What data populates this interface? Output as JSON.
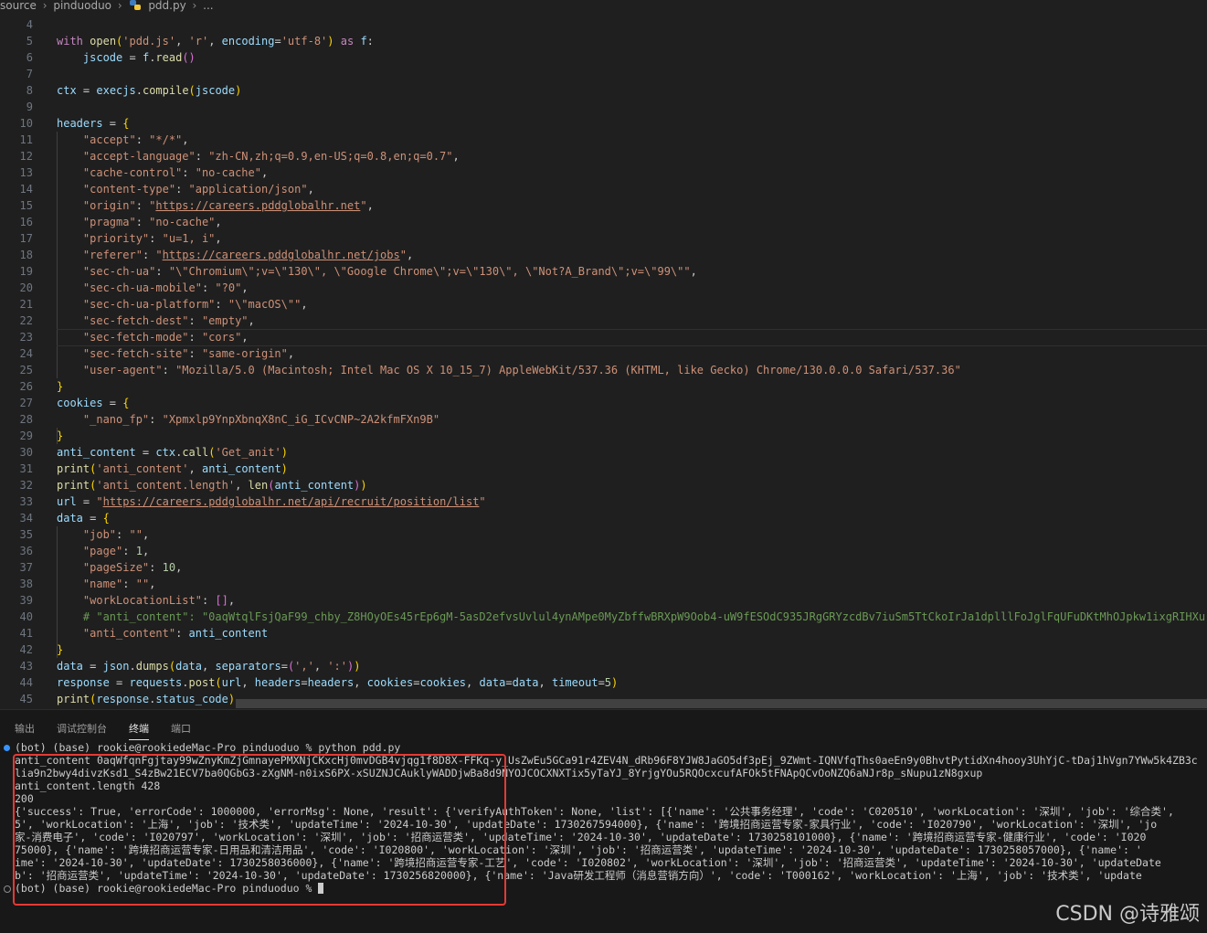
{
  "breadcrumb": {
    "parts": [
      "source",
      "pinduoduo",
      "pdd.py",
      "..."
    ]
  },
  "editor": {
    "lines": [
      {
        "n": "4",
        "html": ""
      },
      {
        "n": "5",
        "html": "<span class='k'>with</span> <span class='f'>open</span><span class='p'>(</span><span class='s'>'pdd.js'</span>, <span class='s'>'r'</span>, <span class='v'>encoding</span>=<span class='s'>'utf-8'</span><span class='p'>)</span> <span class='k'>as</span> <span class='v'>f</span>:"
      },
      {
        "n": "6",
        "html": "    <span class='v'>jscode</span> = <span class='v'>f</span>.<span class='f'>read</span><span class='br'>()</span>"
      },
      {
        "n": "7",
        "html": ""
      },
      {
        "n": "8",
        "html": "<span class='v'>ctx</span> = <span class='v'>execjs</span>.<span class='f'>compile</span><span class='p'>(</span><span class='v'>jscode</span><span class='p'>)</span>"
      },
      {
        "n": "9",
        "html": ""
      },
      {
        "n": "10",
        "html": "<span class='v'>headers</span> = <span class='p'>{</span>"
      },
      {
        "n": "11",
        "html": "    <span class='s'>\"accept\"</span>: <span class='s'>\"*/*\"</span>,"
      },
      {
        "n": "12",
        "html": "    <span class='s'>\"accept-language\"</span>: <span class='s'>\"zh-CN,zh;q=0.9,en-US;q=0.8,en;q=0.7\"</span>,"
      },
      {
        "n": "13",
        "html": "    <span class='s'>\"cache-control\"</span>: <span class='s'>\"no-cache\"</span>,"
      },
      {
        "n": "14",
        "html": "    <span class='s'>\"content-type\"</span>: <span class='s'>\"application/json\"</span>,"
      },
      {
        "n": "15",
        "html": "    <span class='s'>\"origin\"</span>: <span class='s'>\"</span><span class='u'>https://careers.pddglobalhr.net</span><span class='s'>\"</span>,"
      },
      {
        "n": "16",
        "html": "    <span class='s'>\"pragma\"</span>: <span class='s'>\"no-cache\"</span>,"
      },
      {
        "n": "17",
        "html": "    <span class='s'>\"priority\"</span>: <span class='s'>\"u=1, i\"</span>,"
      },
      {
        "n": "18",
        "html": "    <span class='s'>\"referer\"</span>: <span class='s'>\"</span><span class='u'>https://careers.pddglobalhr.net/jobs</span><span class='s'>\"</span>,"
      },
      {
        "n": "19",
        "html": "    <span class='s'>\"sec-ch-ua\"</span>: <span class='s'>\"\\\"Chromium\\\";v=\\\"130\\\", \\\"Google Chrome\\\";v=\\\"130\\\", \\\"Not?A_Brand\\\";v=\\\"99\\\"\"</span>,"
      },
      {
        "n": "20",
        "html": "    <span class='s'>\"sec-ch-ua-mobile\"</span>: <span class='s'>\"?0\"</span>,"
      },
      {
        "n": "21",
        "html": "    <span class='s'>\"sec-ch-ua-platform\"</span>: <span class='s'>\"\\\"macOS\\\"\"</span>,"
      },
      {
        "n": "22",
        "html": "    <span class='s'>\"sec-fetch-dest\"</span>: <span class='s'>\"empty\"</span>,"
      },
      {
        "n": "23",
        "html": "    <span class='s'>\"sec-fetch-mode\"</span>: <span class='s'>\"cors\"</span>,"
      },
      {
        "n": "24",
        "html": "    <span class='s'>\"sec-fetch-site\"</span>: <span class='s'>\"same-origin\"</span>,"
      },
      {
        "n": "25",
        "html": "    <span class='s'>\"user-agent\"</span>: <span class='s'>\"Mozilla/5.0 (Macintosh; Intel Mac OS X 10_15_7) AppleWebKit/537.36 (KHTML, like Gecko) Chrome/130.0.0.0 Safari/537.36\"</span>"
      },
      {
        "n": "26",
        "html": "<span class='p'>}</span>"
      },
      {
        "n": "27",
        "html": "<span class='v'>cookies</span> = <span class='p'>{</span>"
      },
      {
        "n": "28",
        "html": "    <span class='s'>\"_nano_fp\"</span>: <span class='s'>\"Xpmxlp9YnpXbnqX8nC_iG_ICvCNP~2A2kfmFXn9B\"</span>"
      },
      {
        "n": "29",
        "html": "<span class='p'>}</span>"
      },
      {
        "n": "30",
        "html": "<span class='v'>anti_content</span> = <span class='v'>ctx</span>.<span class='f'>call</span><span class='p'>(</span><span class='s'>'Get_anit'</span><span class='p'>)</span>"
      },
      {
        "n": "31",
        "html": "<span class='f'>print</span><span class='p'>(</span><span class='s'>'anti_content'</span>, <span class='v'>anti_content</span><span class='p'>)</span>"
      },
      {
        "n": "32",
        "html": "<span class='f'>print</span><span class='p'>(</span><span class='s'>'anti_content.length'</span>, <span class='f'>len</span><span class='br'>(</span><span class='v'>anti_content</span><span class='br'>)</span><span class='p'>)</span>"
      },
      {
        "n": "33",
        "html": "<span class='v'>url</span> = <span class='s'>\"</span><span class='u'>https://careers.pddglobalhr.net/api/recruit/position/list</span><span class='s'>\"</span>"
      },
      {
        "n": "34",
        "html": "<span class='v'>data</span> = <span class='p'>{</span>"
      },
      {
        "n": "35",
        "html": "    <span class='s'>\"job\"</span>: <span class='s'>\"\"</span>,"
      },
      {
        "n": "36",
        "html": "    <span class='s'>\"page\"</span>: <span class='n'>1</span>,"
      },
      {
        "n": "37",
        "html": "    <span class='s'>\"pageSize\"</span>: <span class='n'>10</span>,"
      },
      {
        "n": "38",
        "html": "    <span class='s'>\"name\"</span>: <span class='s'>\"\"</span>,"
      },
      {
        "n": "39",
        "html": "    <span class='s'>\"workLocationList\"</span>: <span class='br'>[]</span>,"
      },
      {
        "n": "40",
        "html": "    <span class='c'># \"anti_content\": \"0aqWtqlFsjQaF99_chby_Z8HOyOEs45rEp6gM-5asD2efvsUvlul4ynAMpe0MyZbffwBRXpW9Oob4-uW9fESOdC935JRgGRYzcdBv7iuSm5TtCkoIrJa1dplllFoJglFqUFuDKtMhOJpkw1ixgRIHXu</span>"
      },
      {
        "n": "41",
        "html": "    <span class='s'>\"anti_content\"</span>: <span class='v'>anti_content</span>"
      },
      {
        "n": "42",
        "html": "<span class='p'>}</span>"
      },
      {
        "n": "43",
        "html": "<span class='v'>data</span> = <span class='v'>json</span>.<span class='f'>dumps</span><span class='p'>(</span><span class='v'>data</span>, <span class='v'>separators</span>=<span class='br'>(</span><span class='s'>','</span>, <span class='s'>':'</span><span class='br'>)</span><span class='p'>)</span>"
      },
      {
        "n": "44",
        "html": "<span class='v'>response</span> = <span class='v'>requests</span>.<span class='f'>post</span><span class='p'>(</span><span class='v'>url</span>, <span class='v'>headers</span>=<span class='v'>headers</span>, <span class='v'>cookies</span>=<span class='v'>cookies</span>, <span class='v'>data</span>=<span class='v'>data</span>, <span class='v'>timeout</span>=<span class='n'>5</span><span class='p'>)</span>"
      },
      {
        "n": "45",
        "html": "<span class='f'>print</span><span class='p'>(</span><span class='v'>response</span>.<span class='v'>status_code</span><span class='p'>)</span>"
      }
    ]
  },
  "panel": {
    "tabs": [
      "输出",
      "调试控制台",
      "终端",
      "端口"
    ],
    "active_tab": "终端",
    "terminal": [
      "(bot) (base) rookie@rookiedeMac-Pro pinduoduo % python pdd.py",
      "anti_content 0aqWfqnFgjtay99wZnyKmZjGmnayePMXNjCKxcHj0mvDGB4vjqg1f8D8X-FFKq-y_UsZwEu5GCa91r4ZEV4N_dRb96F8YJW8JaGO5df3pEj_9ZWmt-IQNVfqThs0aeEn9y0BhvtPytidXn4hooy3UhYjC-tDaj1hVgn7YWw5k4ZB3c",
      "lia9n2bwy4divzKsd1_S4zBw21ECV7ba0QGbG3-zXgNM-n0ixS6PX-xSUZNJCAuklyWADDjwBa8d9NYOJCOCXNXTix5yTaYJ_8YrjgYOu5RQOcxcufAFOk5tFNApQCvOoNZQ6aNJr8p_sNupu1zN8gxup",
      "anti_content.length 428",
      "200",
      "{'success': True, 'errorCode': 1000000, 'errorMsg': None, 'result': {'verifyAuthToken': None, 'list': [{'name': '公共事务经理', 'code': 'C020510', 'workLocation': '深圳', 'job': '综合类',",
      "5', 'workLocation': '上海', 'job': '技术类', 'updateTime': '2024-10-30', 'updateDate': 1730267594000}, {'name': '跨境招商运营专家-家具行业', 'code': 'I020790', 'workLocation': '深圳', 'jo",
      "家-消费电子', 'code': 'I020797', 'workLocation': '深圳', 'job': '招商运营类', 'updateTime': '2024-10-30', 'updateDate': 1730258101000}, {'name': '跨境招商运营专家-健康行业', 'code': 'I020",
      "75000}, {'name': '跨境招商运营专家-日用品和清洁用品', 'code': 'I020800', 'workLocation': '深圳', 'job': '招商运营类', 'updateTime': '2024-10-30', 'updateDate': 1730258057000}, {'name': '",
      "ime': '2024-10-30', 'updateDate': 1730258036000}, {'name': '跨境招商运营专家-工艺', 'code': 'I020802', 'workLocation': '深圳', 'job': '招商运营类', 'updateTime': '2024-10-30', 'updateDate",
      "b': '招商运营类', 'updateTime': '2024-10-30', 'updateDate': 1730256820000}, {'name': 'Java研发工程师（消息营销方向）', 'code': 'T000162', 'workLocation': '上海', 'job': '技术类', 'update",
      "(bot) (base) rookie@rookiedeMac-Pro pinduoduo % "
    ]
  },
  "watermark": "CSDN @诗雅颂"
}
